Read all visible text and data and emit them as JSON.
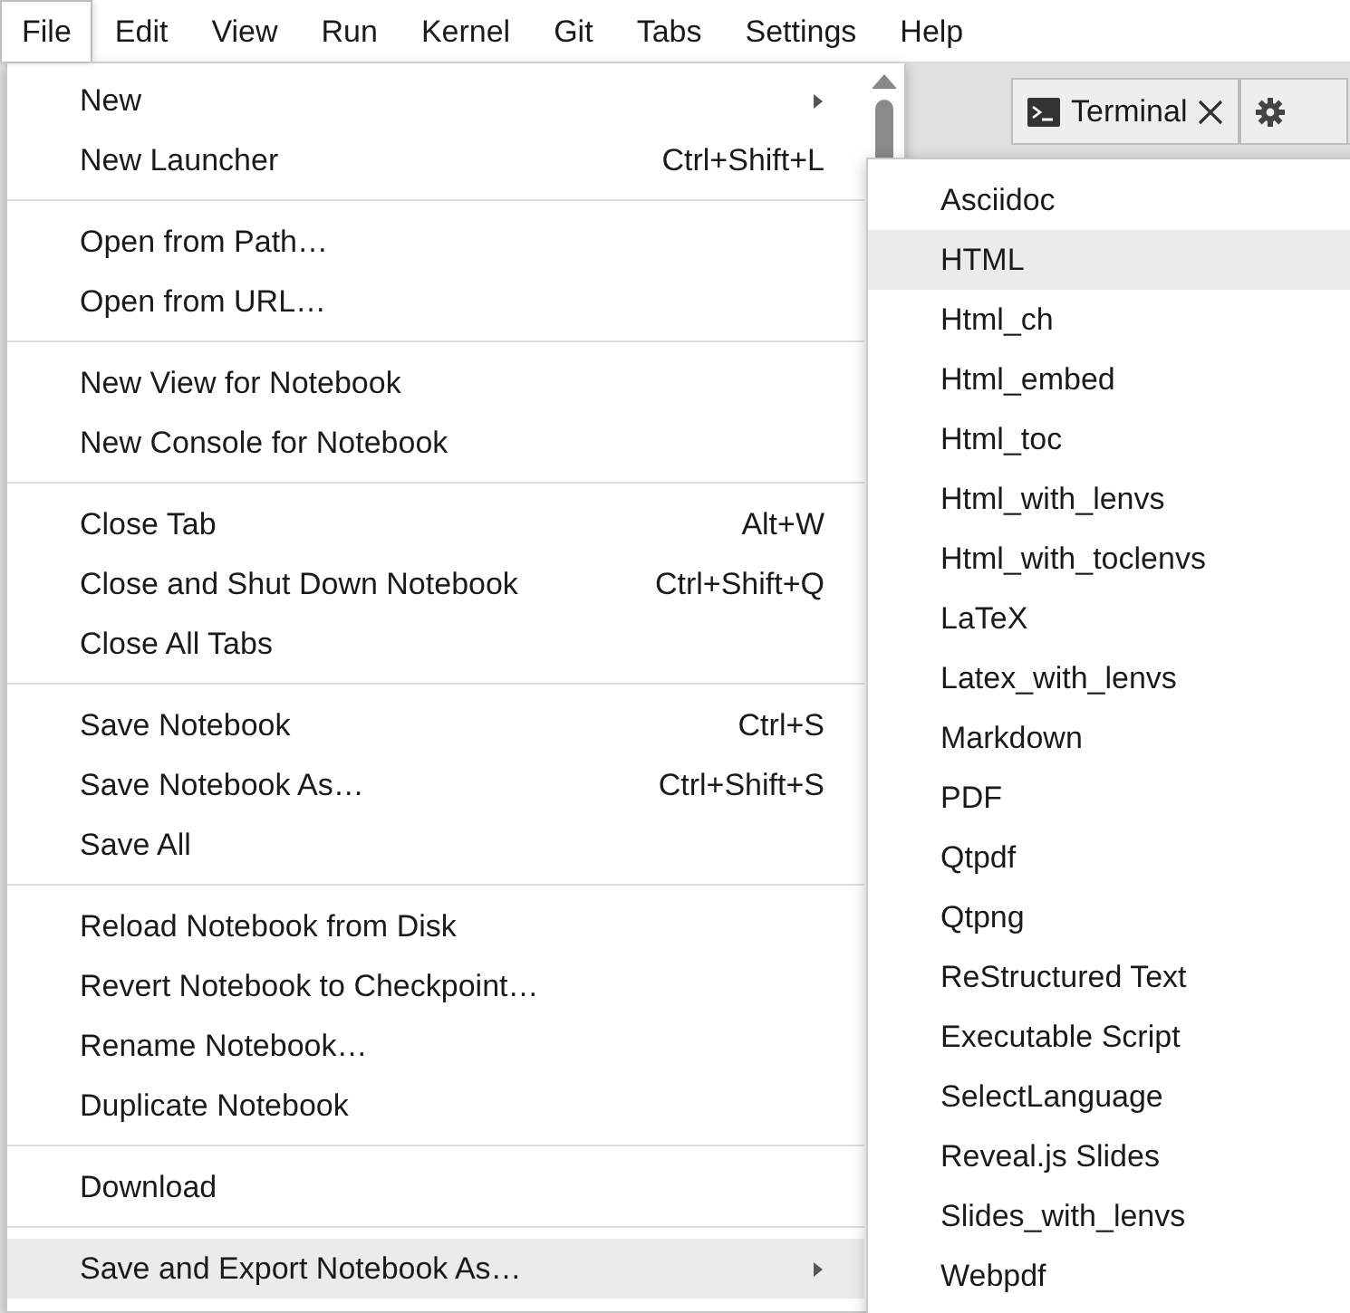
{
  "menubar": [
    {
      "label": "File",
      "selected": true
    },
    {
      "label": "Edit",
      "selected": false
    },
    {
      "label": "View",
      "selected": false
    },
    {
      "label": "Run",
      "selected": false
    },
    {
      "label": "Kernel",
      "selected": false
    },
    {
      "label": "Git",
      "selected": false
    },
    {
      "label": "Tabs",
      "selected": false
    },
    {
      "label": "Settings",
      "selected": false
    },
    {
      "label": "Help",
      "selected": false
    }
  ],
  "tabs": [
    {
      "label": "Terminal",
      "kind": "terminal"
    },
    {
      "kind": "settings"
    }
  ],
  "file_menu": [
    [
      {
        "label": "New",
        "submenu": true,
        "selected": false
      },
      {
        "label": "New Launcher",
        "shortcut": "Ctrl+Shift+L",
        "selected": false
      }
    ],
    [
      {
        "label": "Open from Path…",
        "selected": false
      },
      {
        "label": "Open from URL…",
        "selected": false
      }
    ],
    [
      {
        "label": "New View for Notebook",
        "selected": false
      },
      {
        "label": "New Console for Notebook",
        "selected": false
      }
    ],
    [
      {
        "label": "Close Tab",
        "shortcut": "Alt+W",
        "selected": false
      },
      {
        "label": "Close and Shut Down Notebook",
        "shortcut": "Ctrl+Shift+Q",
        "selected": false
      },
      {
        "label": "Close All Tabs",
        "selected": false
      }
    ],
    [
      {
        "label": "Save Notebook",
        "shortcut": "Ctrl+S",
        "selected": false
      },
      {
        "label": "Save Notebook As…",
        "shortcut": "Ctrl+Shift+S",
        "selected": false
      },
      {
        "label": "Save All",
        "selected": false
      }
    ],
    [
      {
        "label": "Reload Notebook from Disk",
        "selected": false
      },
      {
        "label": "Revert Notebook to Checkpoint…",
        "selected": false
      },
      {
        "label": "Rename Notebook…",
        "selected": false
      },
      {
        "label": "Duplicate Notebook",
        "selected": false
      }
    ],
    [
      {
        "label": "Download",
        "selected": false
      }
    ],
    [
      {
        "label": "Save and Export Notebook As…",
        "submenu": true,
        "selected": true
      }
    ]
  ],
  "export_menu": [
    {
      "label": "Asciidoc",
      "selected": false
    },
    {
      "label": "HTML",
      "selected": true
    },
    {
      "label": "Html_ch",
      "selected": false
    },
    {
      "label": "Html_embed",
      "selected": false
    },
    {
      "label": "Html_toc",
      "selected": false
    },
    {
      "label": "Html_with_lenvs",
      "selected": false
    },
    {
      "label": "Html_with_toclenvs",
      "selected": false
    },
    {
      "label": "LaTeX",
      "selected": false
    },
    {
      "label": "Latex_with_lenvs",
      "selected": false
    },
    {
      "label": "Markdown",
      "selected": false
    },
    {
      "label": "PDF",
      "selected": false
    },
    {
      "label": "Qtpdf",
      "selected": false
    },
    {
      "label": "Qtpng",
      "selected": false
    },
    {
      "label": "ReStructured Text",
      "selected": false
    },
    {
      "label": "Executable Script",
      "selected": false
    },
    {
      "label": "SelectLanguage",
      "selected": false
    },
    {
      "label": "Reveal.js Slides",
      "selected": false
    },
    {
      "label": "Slides_with_lenvs",
      "selected": false
    },
    {
      "label": "Webpdf",
      "selected": false
    }
  ]
}
